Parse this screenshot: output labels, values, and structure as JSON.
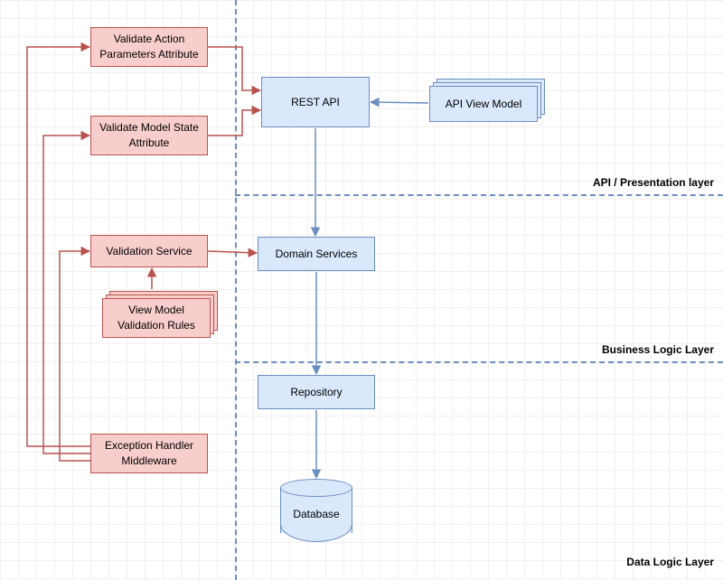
{
  "nodes": {
    "validateAction": "Validate Action Parameters Attribute",
    "validateModel": "Validate Model State Attribute",
    "validationService": "Validation Service",
    "viewModelRules": "View Model Validation Rules",
    "exceptionHandler": "Exception Handler Middleware",
    "restApi": "REST API",
    "apiViewModel": "API View Model",
    "domainServices": "Domain Services",
    "repository": "Repository",
    "database": "Database"
  },
  "layers": {
    "api": "API / Presentation layer",
    "business": "Business Logic Layer",
    "data": "Data Logic Layer"
  },
  "colors": {
    "pinkFill": "#f8cecc",
    "pinkStroke": "#b85450",
    "blueFill": "#dae8fc",
    "blueStroke": "#6c8ebf"
  },
  "diagram_type": "layered-architecture",
  "edges": [
    {
      "from": "validateAction",
      "to": "restApi",
      "color": "red"
    },
    {
      "from": "validateModel",
      "to": "restApi",
      "color": "red"
    },
    {
      "from": "validationService",
      "to": "domainServices",
      "color": "red"
    },
    {
      "from": "viewModelRules",
      "to": "validationService",
      "color": "red"
    },
    {
      "from": "exceptionHandler",
      "to": "validateAction",
      "color": "red",
      "routing": "orthogonal"
    },
    {
      "from": "exceptionHandler",
      "to": "validateModel",
      "color": "red",
      "routing": "orthogonal"
    },
    {
      "from": "exceptionHandler",
      "to": "validationService",
      "color": "red",
      "routing": "orthogonal"
    },
    {
      "from": "apiViewModel",
      "to": "restApi",
      "color": "blue"
    },
    {
      "from": "restApi",
      "to": "domainServices",
      "color": "blue"
    },
    {
      "from": "domainServices",
      "to": "repository",
      "color": "blue"
    },
    {
      "from": "repository",
      "to": "database",
      "color": "blue"
    }
  ]
}
